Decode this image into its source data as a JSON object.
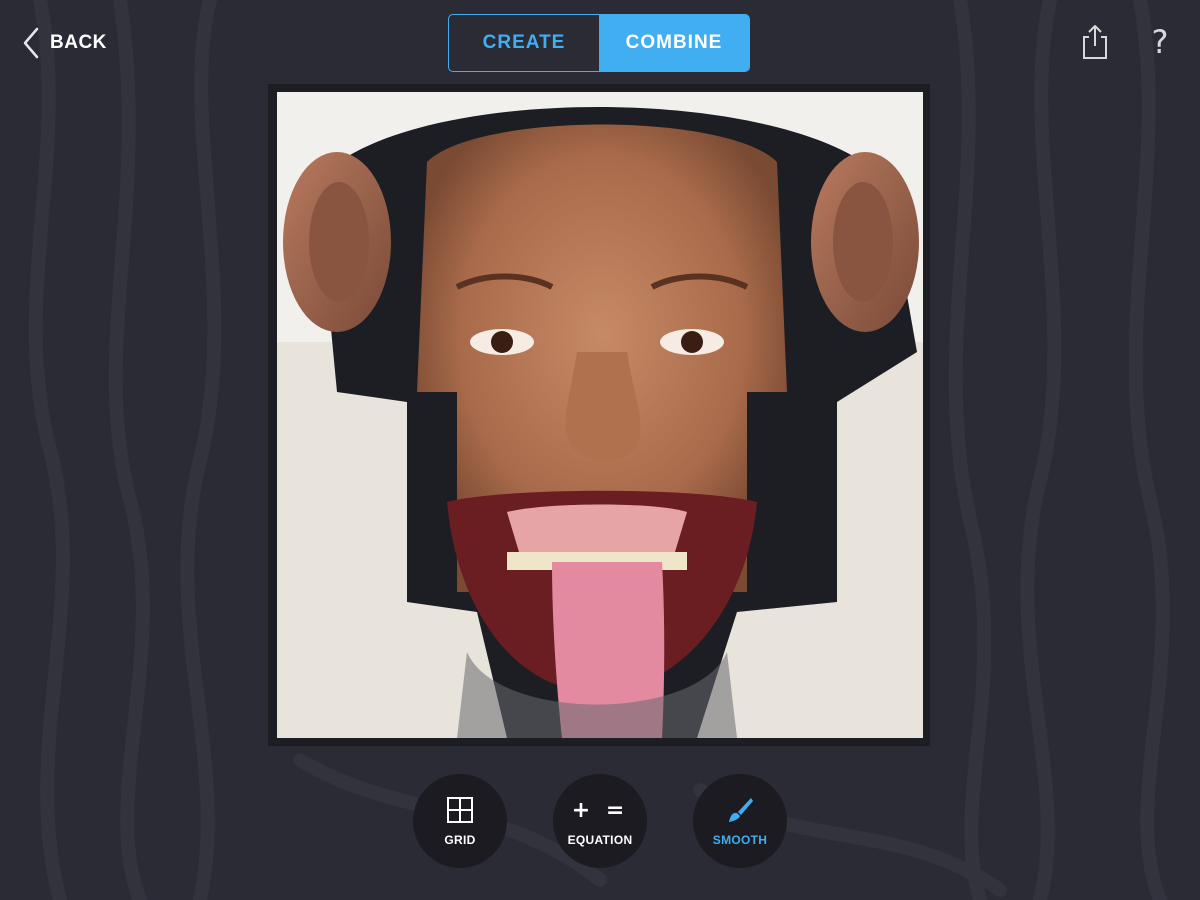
{
  "header": {
    "back_label": "BACK",
    "back_icon": "chevron-left-icon",
    "tabs": [
      {
        "label": "CREATE",
        "selected": false
      },
      {
        "label": "COMBINE",
        "selected": true
      }
    ],
    "share_icon": "share-icon",
    "help_icon": "help-icon",
    "help_glyph": "?"
  },
  "canvas": {
    "content": "face-morph-image"
  },
  "toolbar": {
    "buttons": [
      {
        "label": "GRID",
        "icon": "grid-icon",
        "active": false
      },
      {
        "label": "EQUATION",
        "icon": "equation-icon",
        "glyph": "+ =",
        "active": false
      },
      {
        "label": "SMOOTH",
        "icon": "brush-icon",
        "active": true
      }
    ]
  },
  "colors": {
    "accent": "#41aef2",
    "background": "#2b2b35",
    "button_bg": "#1b1b21"
  }
}
